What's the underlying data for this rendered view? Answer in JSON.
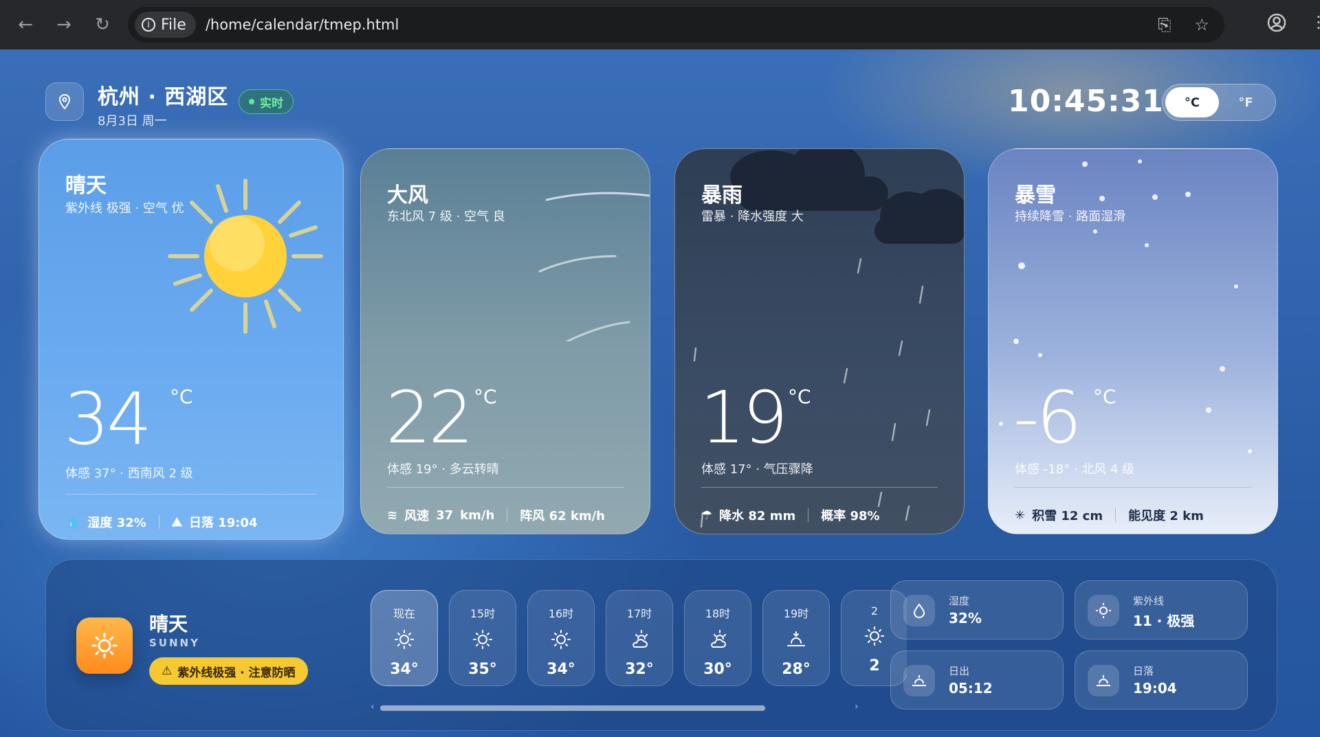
{
  "browser": {
    "chip_label": "File",
    "url": "/home/calendar/tmep.html"
  },
  "header": {
    "location": "杭州 · 西湖区",
    "date": "8月3日 周一",
    "live_label": "实时",
    "clock": "10:45:31",
    "unit_celsius": "°C",
    "unit_fahrenheit": "°F",
    "active_unit": "°C"
  },
  "cards": {
    "sunny": {
      "title": "晴天",
      "subtitle": "紫外线 极强 · 空气 优",
      "temp": "34",
      "unit": "°C",
      "feel": "体感 37° · 西南风 2 级",
      "humidity": "湿度 32%",
      "sunset": "日落 19:04"
    },
    "windy": {
      "title": "大风",
      "subtitle": "东北风 7 级 · 空气 良",
      "temp": "22",
      "unit": "°C",
      "feel": "体感 19° · 多云转晴",
      "speed_label": "风速",
      "speed_value": "37",
      "speed_unit": "km/h",
      "gust": "阵风 62 km/h"
    },
    "rain": {
      "title": "暴雨",
      "subtitle": "雷暴 · 降水强度 大",
      "temp": "19",
      "unit": "°C",
      "feel": "体感 17° · 气压骤降",
      "precip": "降水 82 mm",
      "prob": "概率 98%"
    },
    "snow": {
      "title": "暴雪",
      "subtitle": "持续降雪 · 路面湿滑",
      "temp": "-6",
      "unit": "°C",
      "feel": "体感 -18° · 北风 4 级",
      "depth": "积雪 12 cm",
      "visibility": "能见度 2 km"
    }
  },
  "current": {
    "title": "晴天",
    "subtitle": "SUNNY",
    "warning": "紫外线极强 · 注意防晒"
  },
  "hourly": [
    {
      "label": "现在",
      "icon": "sun-icon",
      "temp": "34°"
    },
    {
      "label": "15时",
      "icon": "sun-icon",
      "temp": "35°"
    },
    {
      "label": "16时",
      "icon": "sun-icon",
      "temp": "34°"
    },
    {
      "label": "17时",
      "icon": "partly-cloudy-icon",
      "temp": "32°"
    },
    {
      "label": "18时",
      "icon": "partly-cloudy-icon",
      "temp": "30°"
    },
    {
      "label": "19时",
      "icon": "sunset-icon",
      "temp": "28°"
    },
    {
      "label": "2",
      "icon": "sun-icon",
      "temp": "2"
    }
  ],
  "stats": {
    "humidity_label": "湿度",
    "humidity_value": "32%",
    "uv_label": "紫外线",
    "uv_value": "11 · 极强",
    "sunrise_label": "日出",
    "sunrise_value": "05:12",
    "sunset_label": "日落",
    "sunset_value": "19:04"
  },
  "colors": {
    "accent_live": "#5fe89a",
    "warning_bg": "#f7c930",
    "sun": "#ffd23a"
  }
}
